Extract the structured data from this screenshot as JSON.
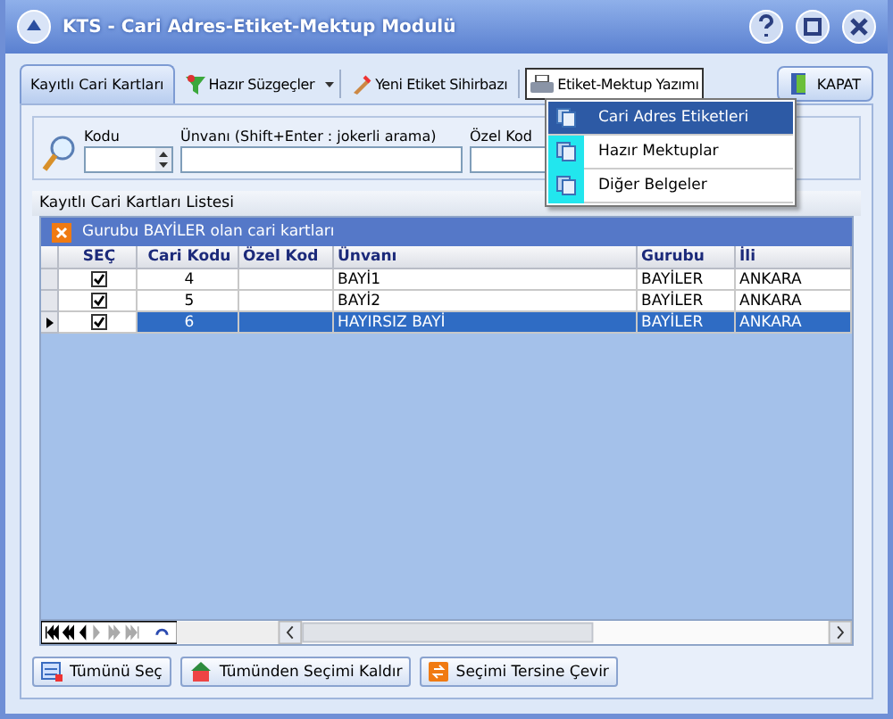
{
  "window": {
    "title": "KTS - Cari Adres-Etiket-Mektup Modulü"
  },
  "toolbar": {
    "tabs": [
      {
        "label": "Kayıtlı Cari Kartları",
        "selected": true
      }
    ],
    "buttons": [
      {
        "label": "Hazır Süzgeçler",
        "kind": "filter",
        "pressed": false
      },
      {
        "label": "Yeni Etiket Sihirbazı",
        "kind": "wizard",
        "pressed": false
      },
      {
        "label": "Etiket-Mektup Yazımı",
        "kind": "print",
        "pressed": true
      }
    ],
    "close_button": "KAPAT"
  },
  "menu": {
    "items": [
      {
        "label": "Cari Adres Etiketleri",
        "selected": true
      },
      {
        "label": "Hazır Mektuplar",
        "selected": false
      },
      {
        "label": "Diğer Belgeler",
        "selected": false
      }
    ]
  },
  "filters": [
    {
      "label": "Kodu",
      "kind": "spin"
    },
    {
      "label": "Ünvanı (Shift+Enter : jokerli arama)",
      "kind": "text"
    },
    {
      "label": "Özel Kod",
      "kind": "text"
    }
  ],
  "list": {
    "title": "Kayıtlı Cari Kartları Listesi",
    "group_filter": "Gurubu BAYİLER olan cari kartları",
    "columns": [
      "SEÇ",
      "Cari Kodu",
      "Özel Kod",
      "Ünvanı",
      "Gurubu",
      "İli"
    ],
    "rows": [
      {
        "checked": true,
        "selected": false,
        "code": "4",
        "special": "",
        "name": "BAYİ1",
        "group": "BAYİLER",
        "city": "ANKARA"
      },
      {
        "checked": true,
        "selected": false,
        "code": "5",
        "special": "",
        "name": "BAYİ2",
        "group": "BAYİLER",
        "city": "ANKARA"
      },
      {
        "checked": true,
        "selected": true,
        "code": "6",
        "special": "",
        "name": "HAYIRSIZ BAYİ",
        "group": "BAYİLER",
        "city": "ANKARA"
      }
    ]
  },
  "actions": [
    {
      "label": "Tümünü Seç",
      "kind": "select"
    },
    {
      "label": "Tümünden Seçimi Kaldır",
      "kind": "clear"
    },
    {
      "label": "Seçimi Tersine Çevir",
      "kind": "invert"
    }
  ]
}
